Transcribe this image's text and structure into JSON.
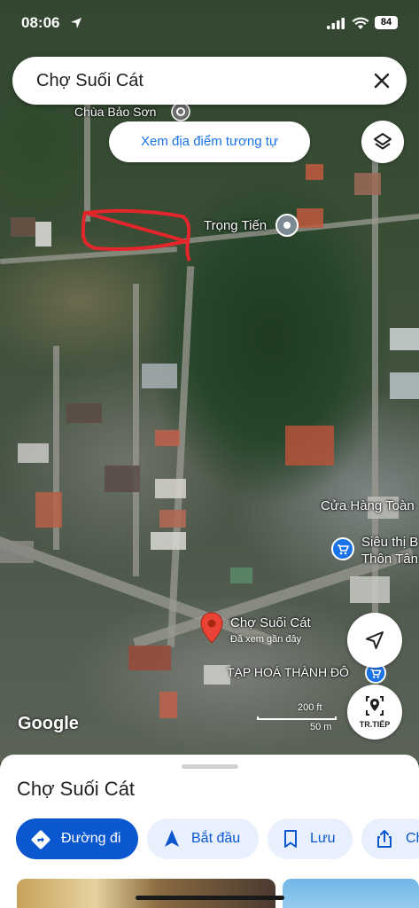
{
  "status_bar": {
    "time": "08:06",
    "battery": "84"
  },
  "search": {
    "query": "Chợ Suối Cát"
  },
  "map": {
    "similar_places_label": "Xem địa điểm tương tự",
    "labels": {
      "pagoda": "Chùa Bảo Sơn",
      "trong_tien": "Trọng Tiến",
      "store_toan": "Cửa Hàng Toàn",
      "supermarket_line1": "Siêu thị B",
      "supermarket_line2": "Thôn Tân",
      "market_name": "Chợ Suối Cát",
      "market_sub": "Đã xem gần đây",
      "grocery": "TẠP HOÁ THÀNH ĐÔ"
    },
    "google": "Google",
    "scale_ft": "200 ft",
    "scale_m": "50 m",
    "street_view_label": "TR.TIẾP"
  },
  "sheet": {
    "title": "Chợ Suối Cát",
    "directions_label": "Đường đi",
    "start_label": "Bắt đầu",
    "save_label": "Lưu",
    "share_label": "Ch"
  }
}
